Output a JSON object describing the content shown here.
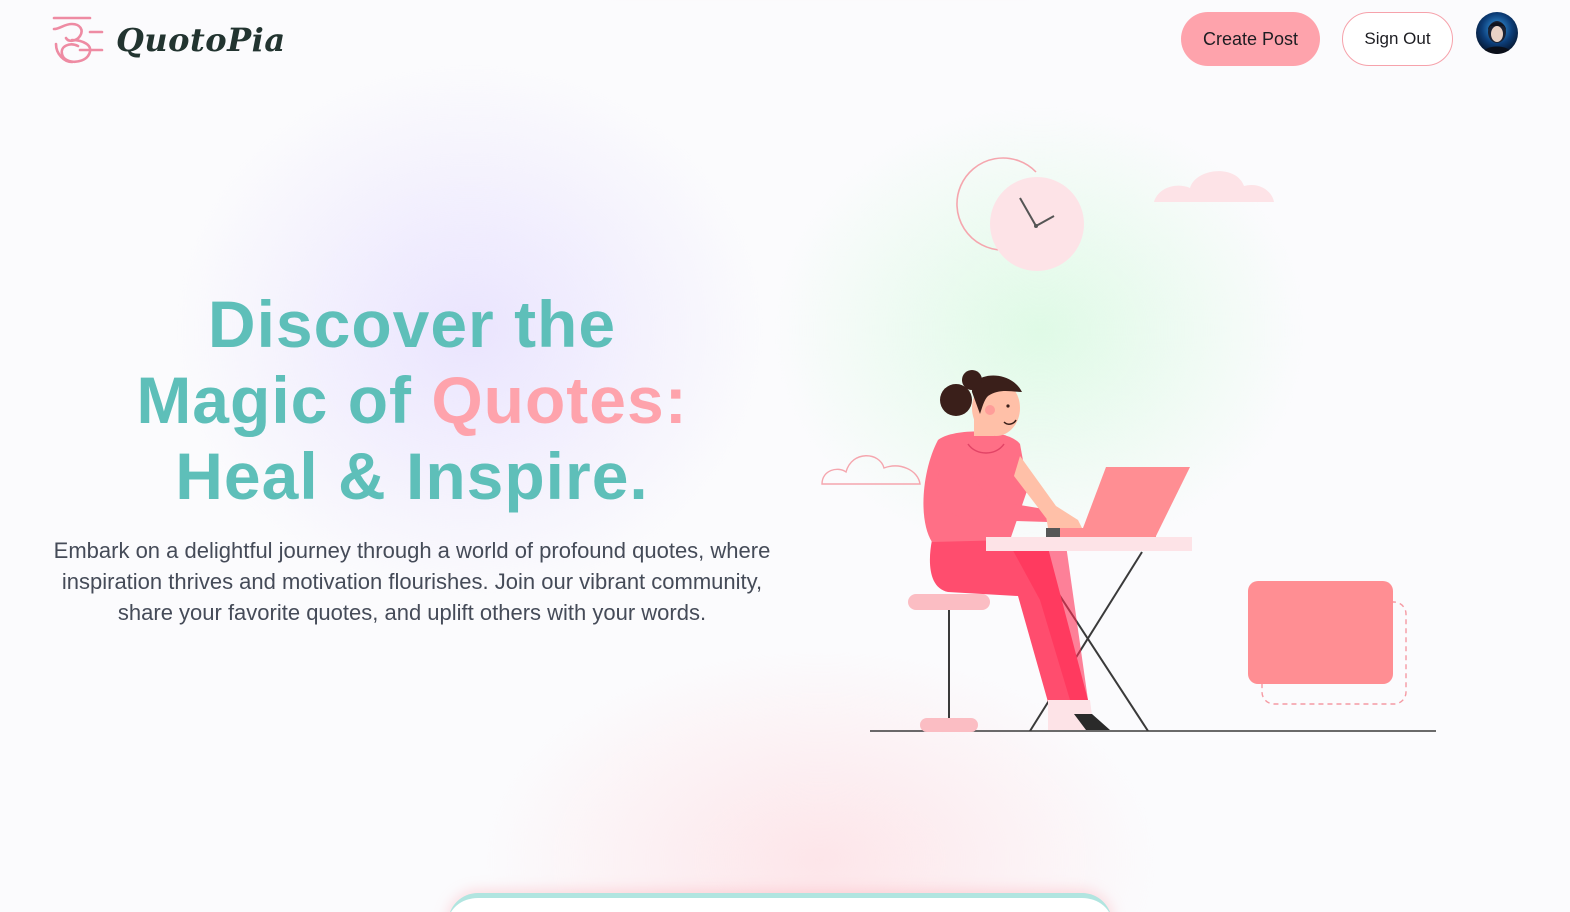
{
  "header": {
    "brand_name": "QuotoPia",
    "create_post_label": "Create Post",
    "sign_out_label": "Sign Out"
  },
  "hero": {
    "title_line1": "Discover the",
    "title_line2_prefix": "Magic of",
    "title_line2_accent": "Quotes:",
    "title_line3": "Heal & Inspire.",
    "subtitle": "Embark on a delightful journey through a world of profound quotes, where inspiration thrives and motivation flourishes. Join our vibrant community, share your favorite quotes, and uplift others with your words."
  },
  "colors": {
    "teal": "#5ebfb9",
    "pink": "#fea3ac",
    "coral": "#ff8e93",
    "dark_text": "#223430"
  },
  "icons": [
    "logo-icon",
    "avatar",
    "clock-icon",
    "cloud-icon",
    "person-at-laptop-illustration"
  ]
}
